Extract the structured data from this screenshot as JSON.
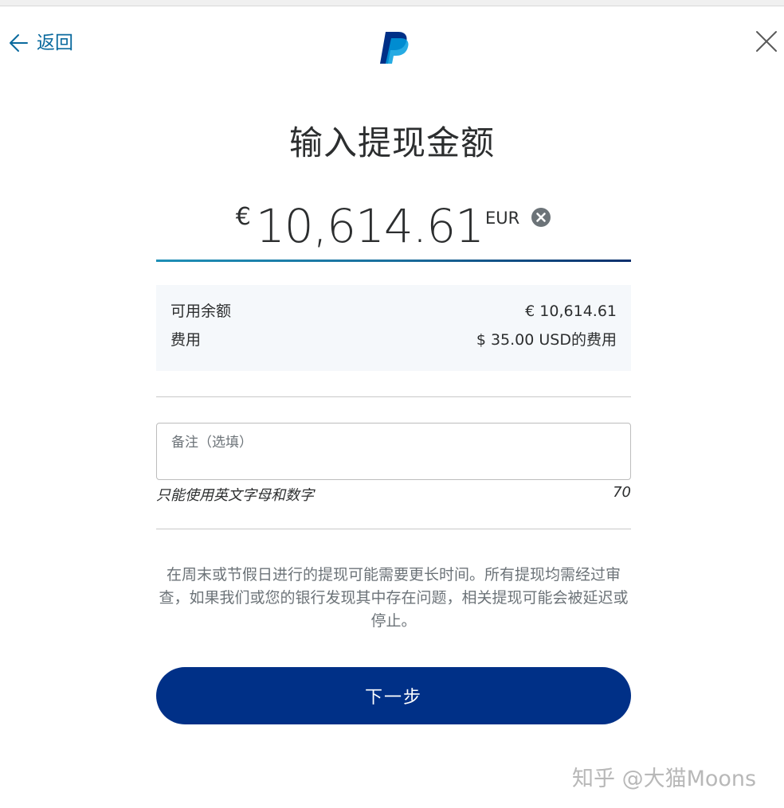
{
  "header": {
    "back_label": "返回"
  },
  "title": "输入提现金额",
  "amount": {
    "symbol": "€",
    "value": "10,614.61",
    "currency": "EUR"
  },
  "summary": {
    "rows": [
      {
        "label": "可用余额",
        "value": "€ 10,614.61"
      },
      {
        "label": "费用",
        "value": "$ 35.00 USD的费用"
      }
    ]
  },
  "note": {
    "placeholder": "备注（选填）",
    "hint": "只能使用英文字母和数字",
    "remaining": "70"
  },
  "disclaimer": "在周末或节假日进行的提现可能需要更长时间。所有提现均需经过审查，如果我们或您的银行发现其中存在问题，相关提现可能会被延迟或停止。",
  "next_button": "下一步",
  "watermark": "知乎 @大猫Moons",
  "colors": {
    "brand_dark": "#003087",
    "brand_light": "#009cde",
    "link": "#0070ba"
  }
}
